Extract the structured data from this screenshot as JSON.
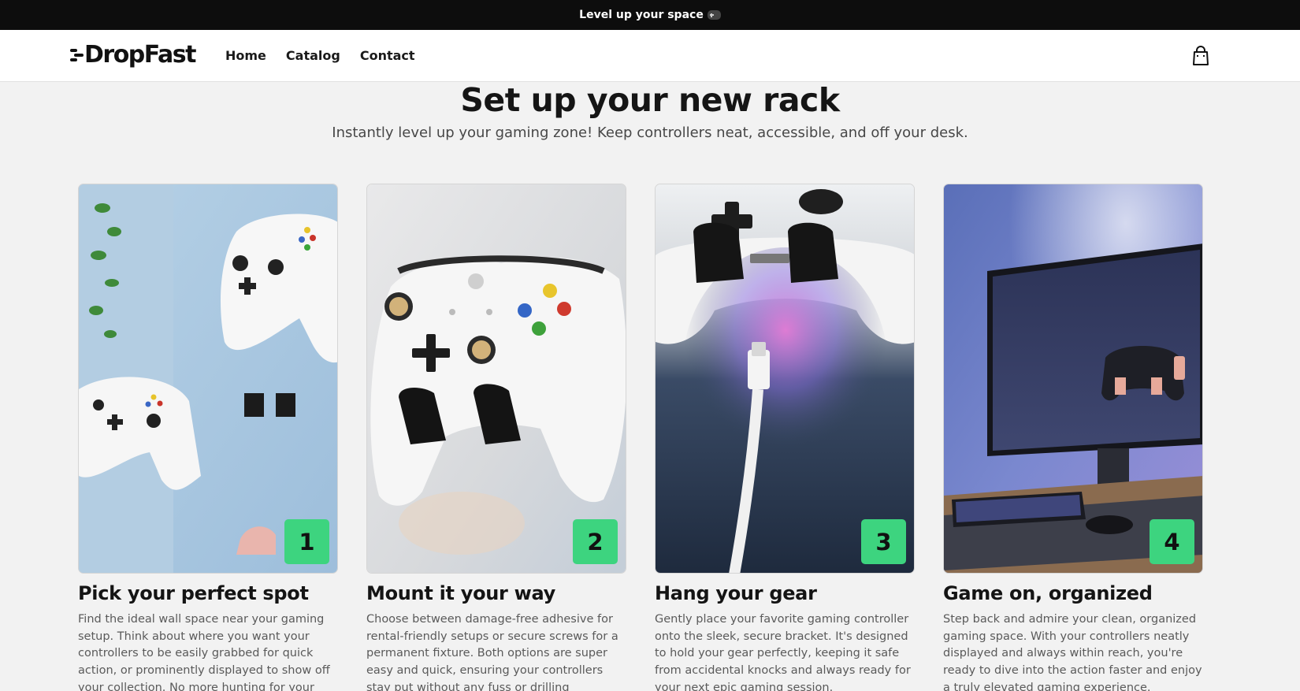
{
  "announcement": {
    "text": "Level up your space",
    "icon": "gamepad-icon"
  },
  "brand": {
    "name": "DropFast",
    "accent": "#3dd47f"
  },
  "nav": {
    "items": [
      {
        "label": "Home"
      },
      {
        "label": "Catalog"
      },
      {
        "label": "Contact"
      }
    ]
  },
  "cart": {
    "icon": "shopping-bag-icon"
  },
  "hero": {
    "title": "Set up your new rack",
    "subtitle": "Instantly level up your gaming zone! Keep controllers neat, accessible, and off your desk."
  },
  "steps": [
    {
      "number": "1",
      "title": "Pick your perfect spot",
      "text": "Find the ideal wall space near your gaming setup. Think about where you want your controllers to be easily grabbed for quick action, or prominently displayed to show off your collection. No more hunting for your gear!"
    },
    {
      "number": "2",
      "title": "Mount it your way",
      "text": "Choose between damage-free adhesive for rental-friendly setups or secure screws for a permanent fixture. Both options are super easy and quick, ensuring your controllers stay put without any fuss or drilling headaches."
    },
    {
      "number": "3",
      "title": "Hang your gear",
      "text": "Gently place your favorite gaming controller onto the sleek, secure bracket. It's designed to hold your gear perfectly, keeping it safe from accidental knocks and always ready for your next epic gaming session."
    },
    {
      "number": "4",
      "title": "Game on, organized",
      "text": "Step back and admire your clean, organized gaming space. With your controllers neatly displayed and always within reach, you're ready to dive into the action faster and enjoy a truly elevated gaming experience."
    }
  ]
}
